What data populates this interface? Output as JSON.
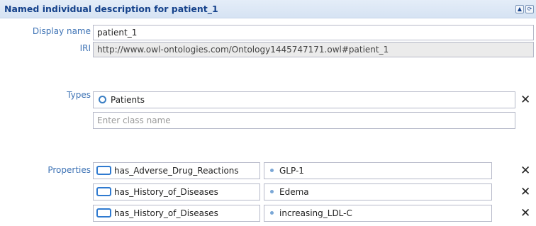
{
  "header": {
    "title": "Named individual description for patient_1"
  },
  "display_name": {
    "label": "Display name",
    "value": "patient_1"
  },
  "iri": {
    "label": "IRI",
    "value": "http://www.owl-ontologies.com/Ontology1445747171.owl#patient_1"
  },
  "types": {
    "label": "Types",
    "items": [
      {
        "label": "Patients"
      }
    ],
    "input_placeholder": "Enter class name"
  },
  "properties": {
    "label": "Properties",
    "rows": [
      {
        "property": "has_Adverse_Drug_Reactions",
        "value": "GLP-1"
      },
      {
        "property": "has_History_of_Diseases",
        "value": "Edema"
      },
      {
        "property": "has_History_of_Diseases",
        "value": "increasing_LDL-C"
      }
    ]
  },
  "icons": {
    "collapse": "collapse-up-icon",
    "refresh": "refresh-icon",
    "remove": "remove-x-icon",
    "class": "class-circle-icon",
    "property": "object-property-icon",
    "individual": "individual-dot-icon"
  },
  "colors": {
    "header_bg": "#d6e3f3",
    "header_text": "#15428b",
    "label_text": "#3e73b5"
  }
}
